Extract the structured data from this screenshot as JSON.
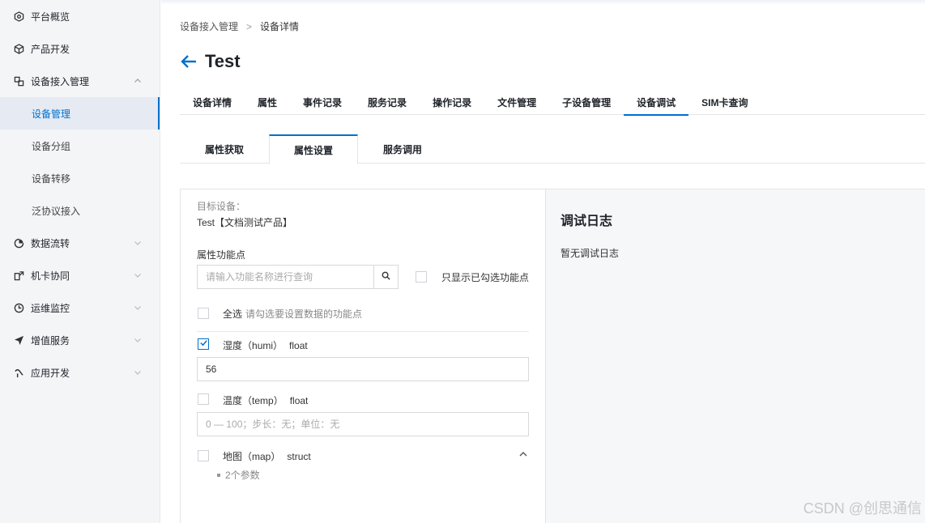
{
  "sidebar": {
    "items": [
      {
        "label": "平台概览",
        "icon": "overview-icon"
      },
      {
        "label": "产品开发",
        "icon": "cube-icon"
      },
      {
        "label": "设备接入管理",
        "icon": "device-access-icon",
        "expanded": true,
        "children": [
          {
            "label": "设备管理",
            "active": true
          },
          {
            "label": "设备分组"
          },
          {
            "label": "设备转移"
          },
          {
            "label": "泛协议接入"
          }
        ]
      },
      {
        "label": "数据流转",
        "icon": "data-flow-icon"
      },
      {
        "label": "机卡协同",
        "icon": "card-sync-icon"
      },
      {
        "label": "运维监控",
        "icon": "monitor-icon"
      },
      {
        "label": "增值服务",
        "icon": "value-service-icon"
      },
      {
        "label": "应用开发",
        "icon": "app-dev-icon"
      }
    ]
  },
  "breadcrumb": {
    "parent": "设备接入管理",
    "separator": ">",
    "current": "设备详情"
  },
  "page": {
    "title": "Test"
  },
  "tabs": [
    "设备详情",
    "属性",
    "事件记录",
    "服务记录",
    "操作记录",
    "文件管理",
    "子设备管理",
    "设备调试",
    "SIM卡查询"
  ],
  "active_tab": "设备调试",
  "subtabs": [
    "属性获取",
    "属性设置",
    "服务调用"
  ],
  "active_subtab": "属性设置",
  "form": {
    "target_label": "目标设备：",
    "target_value": "Test【文档测试产品】",
    "feature_label": "属性功能点",
    "search_placeholder": "请输入功能名称进行查询",
    "only_checked_label": "只显示已勾选功能点",
    "select_all_label": "全选",
    "select_all_hint": "请勾选要设置数据的功能点",
    "properties": [
      {
        "name": "湿度",
        "id": "（humi）",
        "type": "float",
        "checked": true,
        "value": "56",
        "placeholder": ""
      },
      {
        "name": "温度",
        "id": "（temp）",
        "type": "float",
        "checked": false,
        "value": "",
        "placeholder": "0 — 100；步长：无；单位：无"
      },
      {
        "name": "地图",
        "id": "（map）",
        "type": "struct",
        "checked": false,
        "sub": "2个参数"
      }
    ]
  },
  "log": {
    "title": "调试日志",
    "empty": "暂无调试日志"
  },
  "watermark": "CSDN @创思通信",
  "colors": {
    "accent": "#0070cc",
    "sidebar_bg": "#f4f5f7",
    "active_bg": "#e5eaf3"
  }
}
